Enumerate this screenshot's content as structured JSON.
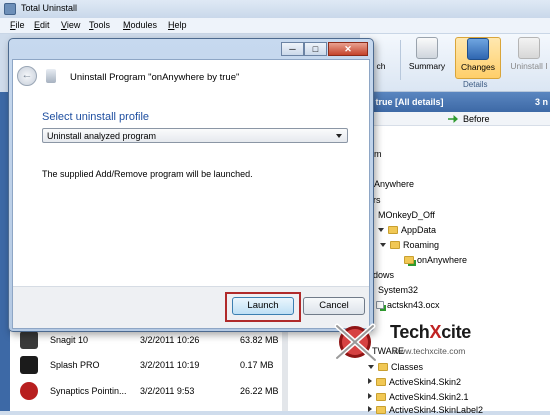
{
  "app": {
    "title": "Total Uninstall",
    "icon": "app-icon"
  },
  "menu": [
    "File",
    "Edit",
    "View",
    "Tools",
    "Modules",
    "Help"
  ],
  "ribbon": {
    "partial_left": "ch",
    "summary": "Summary",
    "changes": "Changes",
    "uninstall": "Uninstall I",
    "group": "Details"
  },
  "right_pane": {
    "header": "y true [All details]",
    "count": "3 n",
    "column_before": "Before",
    "tree": [
      {
        "text": "m"
      },
      {
        "text": "Anywhere"
      },
      {
        "text": "ers"
      },
      {
        "text": "MOnkeyD_Off"
      },
      {
        "text": "AppData"
      },
      {
        "text": "Roaming"
      },
      {
        "text": "onAnywhere"
      },
      {
        "text": "ndows"
      },
      {
        "text": "System32"
      },
      {
        "text": "actskn43.ocx"
      },
      {
        "text": "TWARE"
      },
      {
        "text": "Classes"
      },
      {
        "text": "ActiveSkin4.Skin2"
      },
      {
        "text": "ActiveSkin4.Skin2.1"
      },
      {
        "text": "ActiveSkin4.SkinLabel2"
      }
    ]
  },
  "programs": [
    {
      "name": "Snagit 10",
      "date": "3/2/2011 10:26",
      "size": "63.82 MB",
      "color": "#3a3a3a"
    },
    {
      "name": "Splash PRO",
      "date": "3/2/2011 10:19",
      "size": "0.17 MB",
      "color": "#1b1b1b"
    },
    {
      "name": "Synaptics Pointin...",
      "date": "3/2/2011 9:53",
      "size": "26.22 MB",
      "color": "#b81f1f"
    }
  ],
  "dialog": {
    "title": "Uninstall Program \"onAnywhere by true\"",
    "profile_label": "Select uninstall profile",
    "profile_value": "Uninstall analyzed program",
    "info": "The supplied Add/Remove program will be launched.",
    "launch": "Launch",
    "cancel": "Cancel",
    "ctrl_min": "─",
    "ctrl_max": "□",
    "ctrl_close": "✕"
  },
  "watermark": {
    "text_a": "Tech",
    "text_x": "X",
    "text_b": "cite",
    "url": "www.techxcite.com"
  }
}
